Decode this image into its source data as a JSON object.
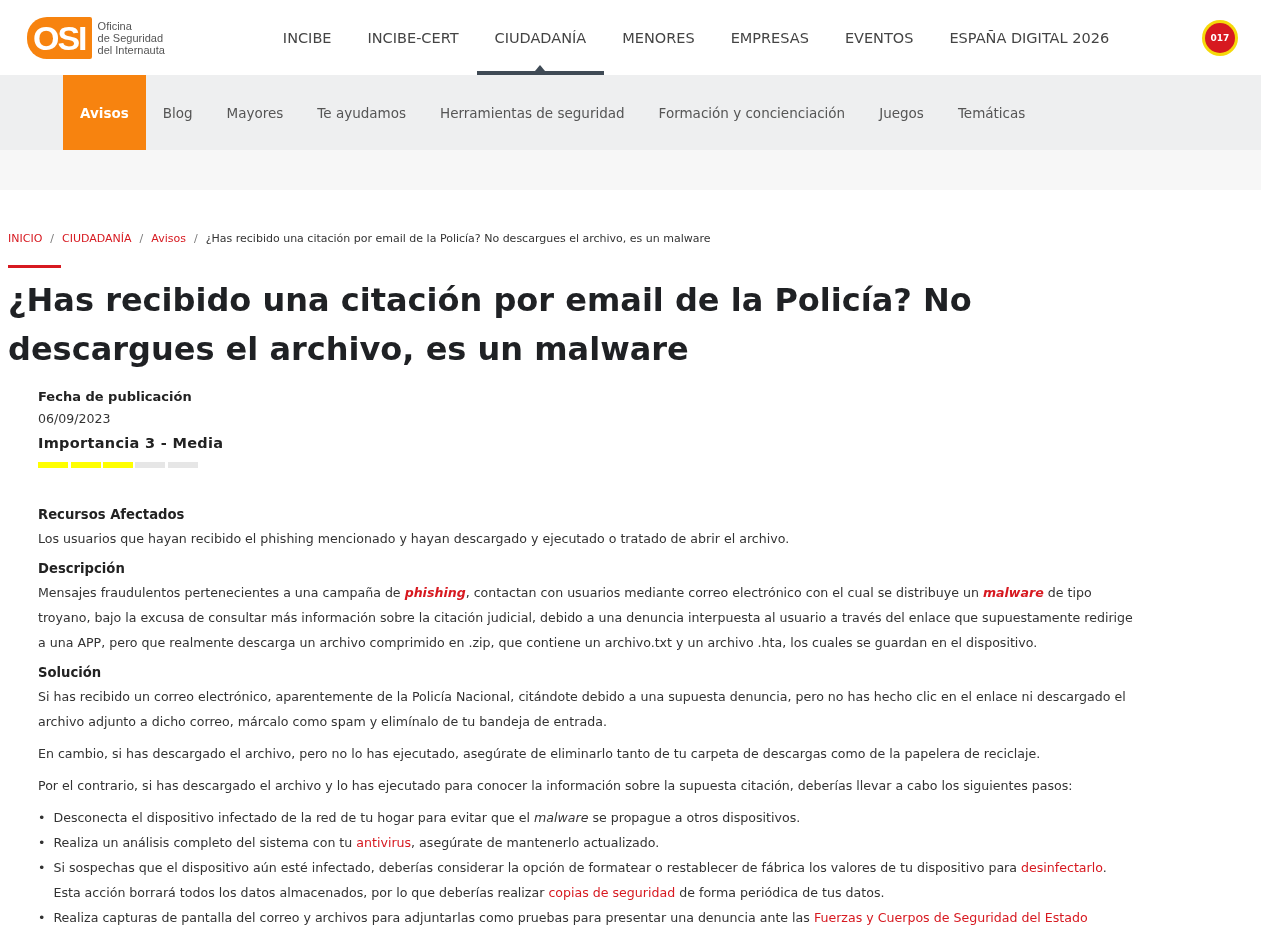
{
  "logo": {
    "mark": "OSI",
    "lines": [
      "Oficina",
      "de Seguridad",
      "del Internauta"
    ]
  },
  "main_nav": [
    {
      "label": "INCIBE",
      "selected": false
    },
    {
      "label": "INCIBE-CERT",
      "selected": false
    },
    {
      "label": "CIUDADANÍA",
      "selected": true
    },
    {
      "label": "MENORES",
      "selected": false
    },
    {
      "label": "EMPRESAS",
      "selected": false
    },
    {
      "label": "EVENTOS",
      "selected": false
    },
    {
      "label": "ESPAÑA DIGITAL 2026",
      "selected": false
    }
  ],
  "helpline_badge": "017",
  "sub_nav": [
    {
      "label": "Avisos",
      "selected": true
    },
    {
      "label": "Blog",
      "selected": false
    },
    {
      "label": "Mayores",
      "selected": false
    },
    {
      "label": "Te ayudamos",
      "selected": false
    },
    {
      "label": "Herramientas de seguridad",
      "selected": false
    },
    {
      "label": "Formación y concienciación",
      "selected": false
    },
    {
      "label": "Juegos",
      "selected": false
    },
    {
      "label": "Temáticas",
      "selected": false
    }
  ],
  "breadcrumb_separator": "/",
  "bullet_marker": "•",
  "breadcrumb": [
    {
      "label": "INICIO",
      "kind": "link"
    },
    {
      "label": "CIUDADANÍA",
      "kind": "link"
    },
    {
      "label": "Avisos",
      "kind": "link"
    },
    {
      "label": "¿Has recibido una citación por email de la Policía? No descargues el archivo, es un malware",
      "kind": "current"
    }
  ],
  "title": "¿Has recibido una citación por email de la Policía? No descargues el archivo, es un malware",
  "meta": {
    "date_label": "Fecha de publicación",
    "date": "06/09/2023",
    "importance": "Importancia 3 - Media",
    "level": 0.6
  },
  "sections": [
    {
      "heading": "Recursos Afectados",
      "blocks": [
        {
          "kind": "paragraph",
          "parts": [
            {
              "kind": "text",
              "text": "Los usuarios que hayan recibido el phishing mencionado y hayan descargado y ejecutado o tratado de abrir el archivo."
            }
          ]
        }
      ]
    },
    {
      "heading": "Descripción",
      "blocks": [
        {
          "kind": "paragraph",
          "parts": [
            {
              "kind": "text",
              "text": "Mensajes fraudulentos pertenecientes a una campaña de "
            },
            {
              "kind": "em-link",
              "text": "phishing"
            },
            {
              "kind": "text",
              "text": ", contactan con usuarios mediante correo electrónico con el cual se distribuye un "
            },
            {
              "kind": "em-link",
              "text": "malware"
            },
            {
              "kind": "text",
              "text": " de tipo troyano, bajo la excusa de consultar más información sobre la citación judicial, debido a una denuncia interpuesta al usuario a través del enlace que supuestamente redirige a una APP, pero que realmente descarga un archivo comprimido en .zip, que contiene un archivo.txt y un archivo .hta, los cuales se guardan en el dispositivo."
            }
          ]
        }
      ]
    },
    {
      "heading": "Solución",
      "blocks": [
        {
          "kind": "paragraph",
          "parts": [
            {
              "kind": "text",
              "text": "Si has recibido un correo electrónico, aparentemente de la Policía Nacional, citándote debido a una supuesta denuncia, pero no has hecho clic en el enlace ni descargado el archivo adjunto a dicho correo, márcalo como spam y elimínalo de tu bandeja de entrada."
            }
          ]
        },
        {
          "kind": "paragraph",
          "parts": [
            {
              "kind": "text",
              "text": "En cambio, si has descargado el archivo, pero no lo has ejecutado, asegúrate de eliminarlo tanto de tu carpeta de descargas como de la papelera de reciclaje."
            }
          ]
        },
        {
          "kind": "paragraph",
          "parts": [
            {
              "kind": "text",
              "text": "Por el contrario, si has descargado el archivo y lo has ejecutado para conocer la información sobre la supuesta citación, deberías llevar a cabo los siguientes pasos:"
            }
          ]
        },
        {
          "kind": "bullet",
          "parts": [
            {
              "kind": "text",
              "text": "Desconecta el dispositivo infectado de la red de tu hogar para evitar que el "
            },
            {
              "kind": "em",
              "text": "malware"
            },
            {
              "kind": "text",
              "text": " se propague a otros dispositivos."
            }
          ]
        },
        {
          "kind": "bullet",
          "parts": [
            {
              "kind": "text",
              "text": "Realiza un análisis completo del sistema con tu "
            },
            {
              "kind": "link",
              "text": "antivirus"
            },
            {
              "kind": "text",
              "text": ", asegúrate de mantenerlo actualizado."
            }
          ]
        },
        {
          "kind": "bullet",
          "parts": [
            {
              "kind": "text",
              "text": "Si sospechas que el dispositivo aún esté infectado, deberías considerar la opción de formatear o restablecer de fábrica los valores de tu dispositivo para "
            },
            {
              "kind": "link",
              "text": "desinfectarlo"
            },
            {
              "kind": "text",
              "text": ". Esta acción borrará todos los datos almacenados, por lo que deberías realizar "
            },
            {
              "kind": "link",
              "text": "copias de seguridad"
            },
            {
              "kind": "text",
              "text": " de forma periódica de tus datos."
            }
          ]
        },
        {
          "kind": "bullet",
          "parts": [
            {
              "kind": "text",
              "text": "Realiza capturas de pantalla del correo y archivos para adjuntarlas como pruebas para presentar una denuncia ante las "
            },
            {
              "kind": "link",
              "text": "Fuerzas y Cuerpos de Seguridad del Estado"
            }
          ]
        }
      ]
    }
  ]
}
